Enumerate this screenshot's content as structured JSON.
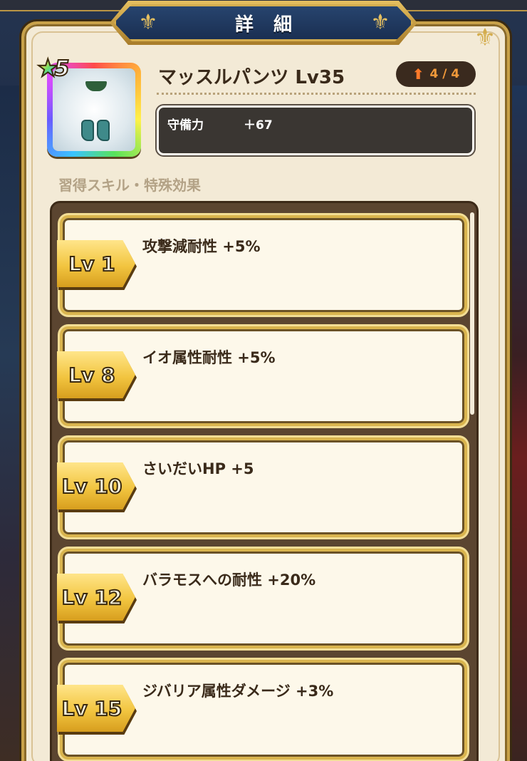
{
  "header": {
    "title": "詳細"
  },
  "item": {
    "name": "マッスルパンツ Lv35",
    "rarity": "5",
    "upgrade": "4 / 4",
    "stats": [
      {
        "label": "守備力",
        "value": "＋67"
      }
    ]
  },
  "section": {
    "label": "習得スキル・特殊効果"
  },
  "skills": [
    {
      "level": "Lv 1",
      "text": "攻撃減耐性 +5%"
    },
    {
      "level": "Lv 8",
      "text": "イオ属性耐性 +5%"
    },
    {
      "level": "Lv 10",
      "text": "さいだいHP +5"
    },
    {
      "level": "Lv 12",
      "text": "バラモスへの耐性 +20%"
    },
    {
      "level": "Lv 15",
      "text": "ジバリア属性ダメージ +3%"
    }
  ],
  "icons": {
    "star": "rainbow-star-icon",
    "upgrade": "up-arrow-icon",
    "item": "muscle-pants-icon"
  },
  "colors": {
    "panel": "#f3ead6",
    "gold": "#d4ad4e",
    "title_banner": "#1a2f52",
    "upgrade_text": "#f29a3a"
  }
}
